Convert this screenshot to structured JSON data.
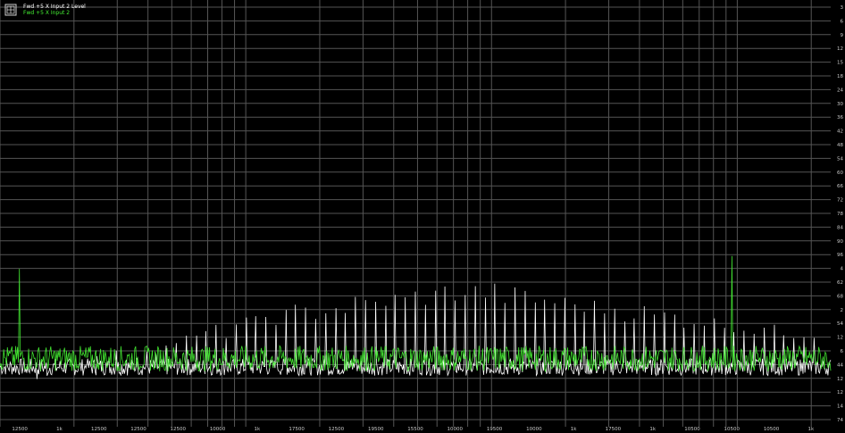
{
  "legend": [
    {
      "label": "Fwd +5 X Input 2 Level",
      "color": "#ffffff"
    },
    {
      "label": "Fwd +5 X Input 2",
      "color": "#44ee33"
    }
  ],
  "chart_data": {
    "type": "line",
    "title": "",
    "xscale": "log",
    "xlim": [
      10,
      24000
    ],
    "grid": true,
    "legend_position": "top-left",
    "x_tick_labels": [
      "12500",
      "1k",
      "12500",
      "12500",
      "12500",
      "10000",
      "1k",
      "17500",
      "12500",
      "19500",
      "15500",
      "10000",
      "19500",
      "10000",
      "1k",
      "17500",
      "1k",
      "10500",
      "10500",
      "10500",
      "1k"
    ],
    "y_tick_labels": [
      "3",
      "6",
      "9",
      "12",
      "15",
      "18",
      "24",
      "30",
      "36",
      "42",
      "48",
      "54",
      "60",
      "66",
      "72",
      "78",
      "84",
      "90",
      "96",
      "4",
      "62",
      "68",
      "2",
      "54",
      "12",
      "6",
      "44",
      "12",
      "12",
      "14",
      "74"
    ],
    "series": [
      {
        "color": "#ffffff",
        "baseline_level": 0.14,
        "noise": 0.02,
        "harmonic_peaks": [
          0.13,
          0.15,
          0.17,
          0.18,
          0.2,
          0.22,
          0.24,
          0.26,
          0.28,
          0.29,
          0.3,
          0.31,
          0.32,
          0.33,
          0.34,
          0.34,
          0.33,
          0.32,
          0.31,
          0.3,
          0.29,
          0.28,
          0.27,
          0.26,
          0.25,
          0.24
        ]
      },
      {
        "color": "#44ee33",
        "baseline_level": 0.16,
        "noise": 0.03,
        "spikes": [
          {
            "x": 12,
            "level": 0.37
          },
          {
            "x": 9500,
            "level": 0.4
          }
        ]
      }
    ]
  }
}
